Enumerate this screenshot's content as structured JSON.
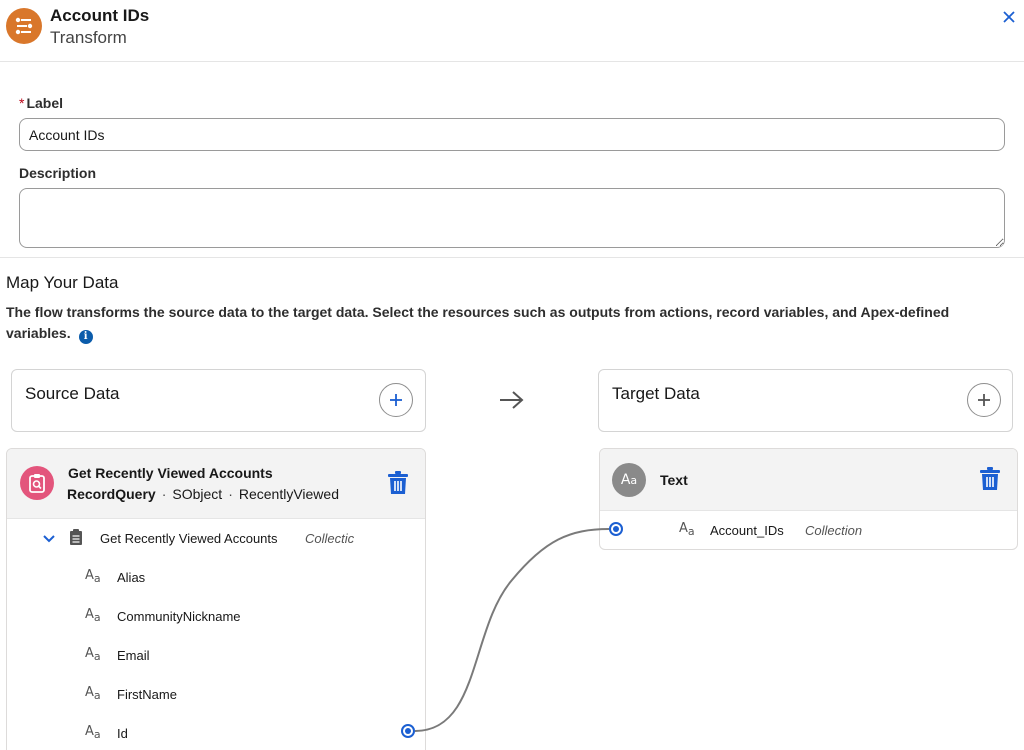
{
  "header": {
    "title": "Account IDs",
    "subtitle": "Transform",
    "icon": "transform-icon",
    "close_icon": "close-icon"
  },
  "form": {
    "label_label": "Label",
    "required_marker": "*",
    "label_value": "Account IDs",
    "description_label": "Description",
    "description_value": ""
  },
  "map": {
    "title": "Map Your Data",
    "description": "The flow transforms the source data to the target data. Select the resources such as outputs from actions, record variables, and Apex-defined variables."
  },
  "source": {
    "title": "Source Data",
    "card": {
      "title": "Get Recently Viewed Accounts",
      "type": "RecordQuery",
      "sep1": "·",
      "kind": "SObject",
      "sep2": "·",
      "name": "RecentlyViewed",
      "group": {
        "label": "Get Recently Viewed Accounts",
        "tag": "Collectic"
      },
      "fields": [
        "Alias",
        "CommunityNickname",
        "Email",
        "FirstName",
        "Id"
      ]
    }
  },
  "target": {
    "title": "Target Data",
    "card": {
      "title": "Text",
      "field": "Account_IDs",
      "tag": "Collection"
    }
  },
  "colors": {
    "brand_blue": "#1b5fd2",
    "transform_orange": "#d9772b",
    "query_pink": "#e3557c",
    "connector": "#7a7a7a"
  }
}
